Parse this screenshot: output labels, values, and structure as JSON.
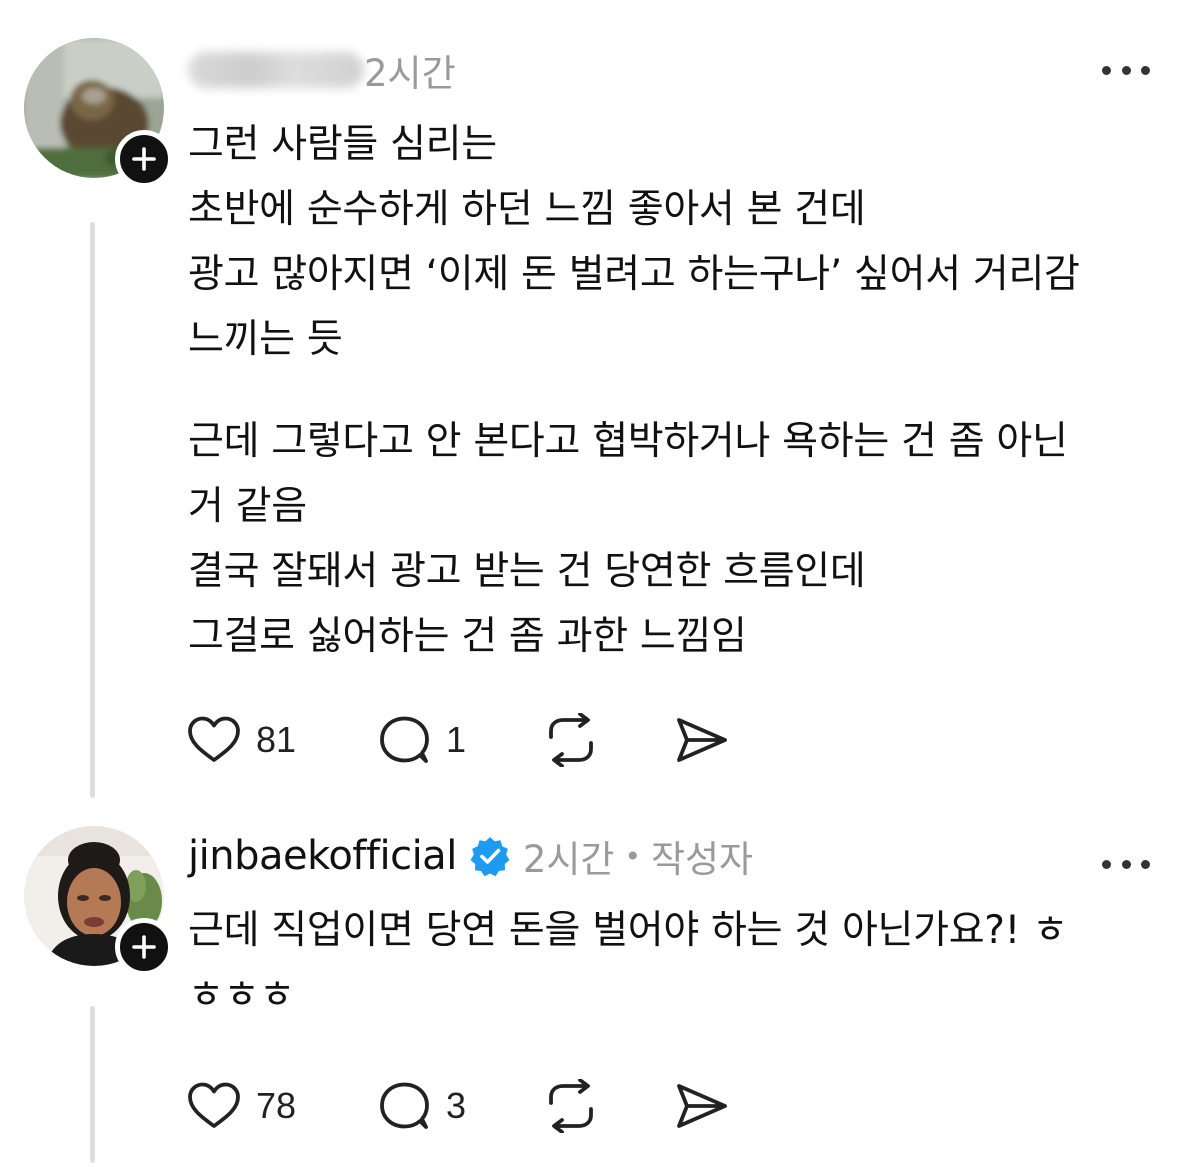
{
  "comments": [
    {
      "username": "",
      "time": "2시간",
      "lines": [
        "그런 사람들 심리는",
        "초반에 순수하게 하던 느낌 좋아서 본 건데",
        "광고 많아지면 ‘이제 돈 벌려고 하는구나’ 싶어서 거리감",
        "느끼는 듯",
        "",
        "근데 그렇다고 안 본다고 협박하거나 욕하는 건 좀 아닌",
        "거 같음",
        "결국 잘돼서 광고 받는 건 당연한 흐름인데",
        "그걸로 싫어하는 건 좀 과한 느낌임"
      ],
      "likes": "81",
      "replies": "1"
    },
    {
      "username": "jinbaekofficial",
      "time": "2시간",
      "separator": "•",
      "author_tag": "작성자",
      "lines": [
        "근데 직업이면 당연 돈을 벌어야 하는 것 아닌가요?! ㅎ",
        "ㅎㅎㅎ"
      ],
      "likes": "78",
      "replies": "3"
    }
  ],
  "icons": {
    "like": "heart-icon",
    "reply": "comment-bubble-icon",
    "repost": "repost-icon",
    "share": "send-icon",
    "more": "more-dots-icon",
    "follow": "plus-icon",
    "verified": "verified-badge-icon"
  },
  "colors": {
    "text": "#111111",
    "meta": "#9a9a9a",
    "verified": "#1d9bf0",
    "thread_line": "#dedede"
  }
}
